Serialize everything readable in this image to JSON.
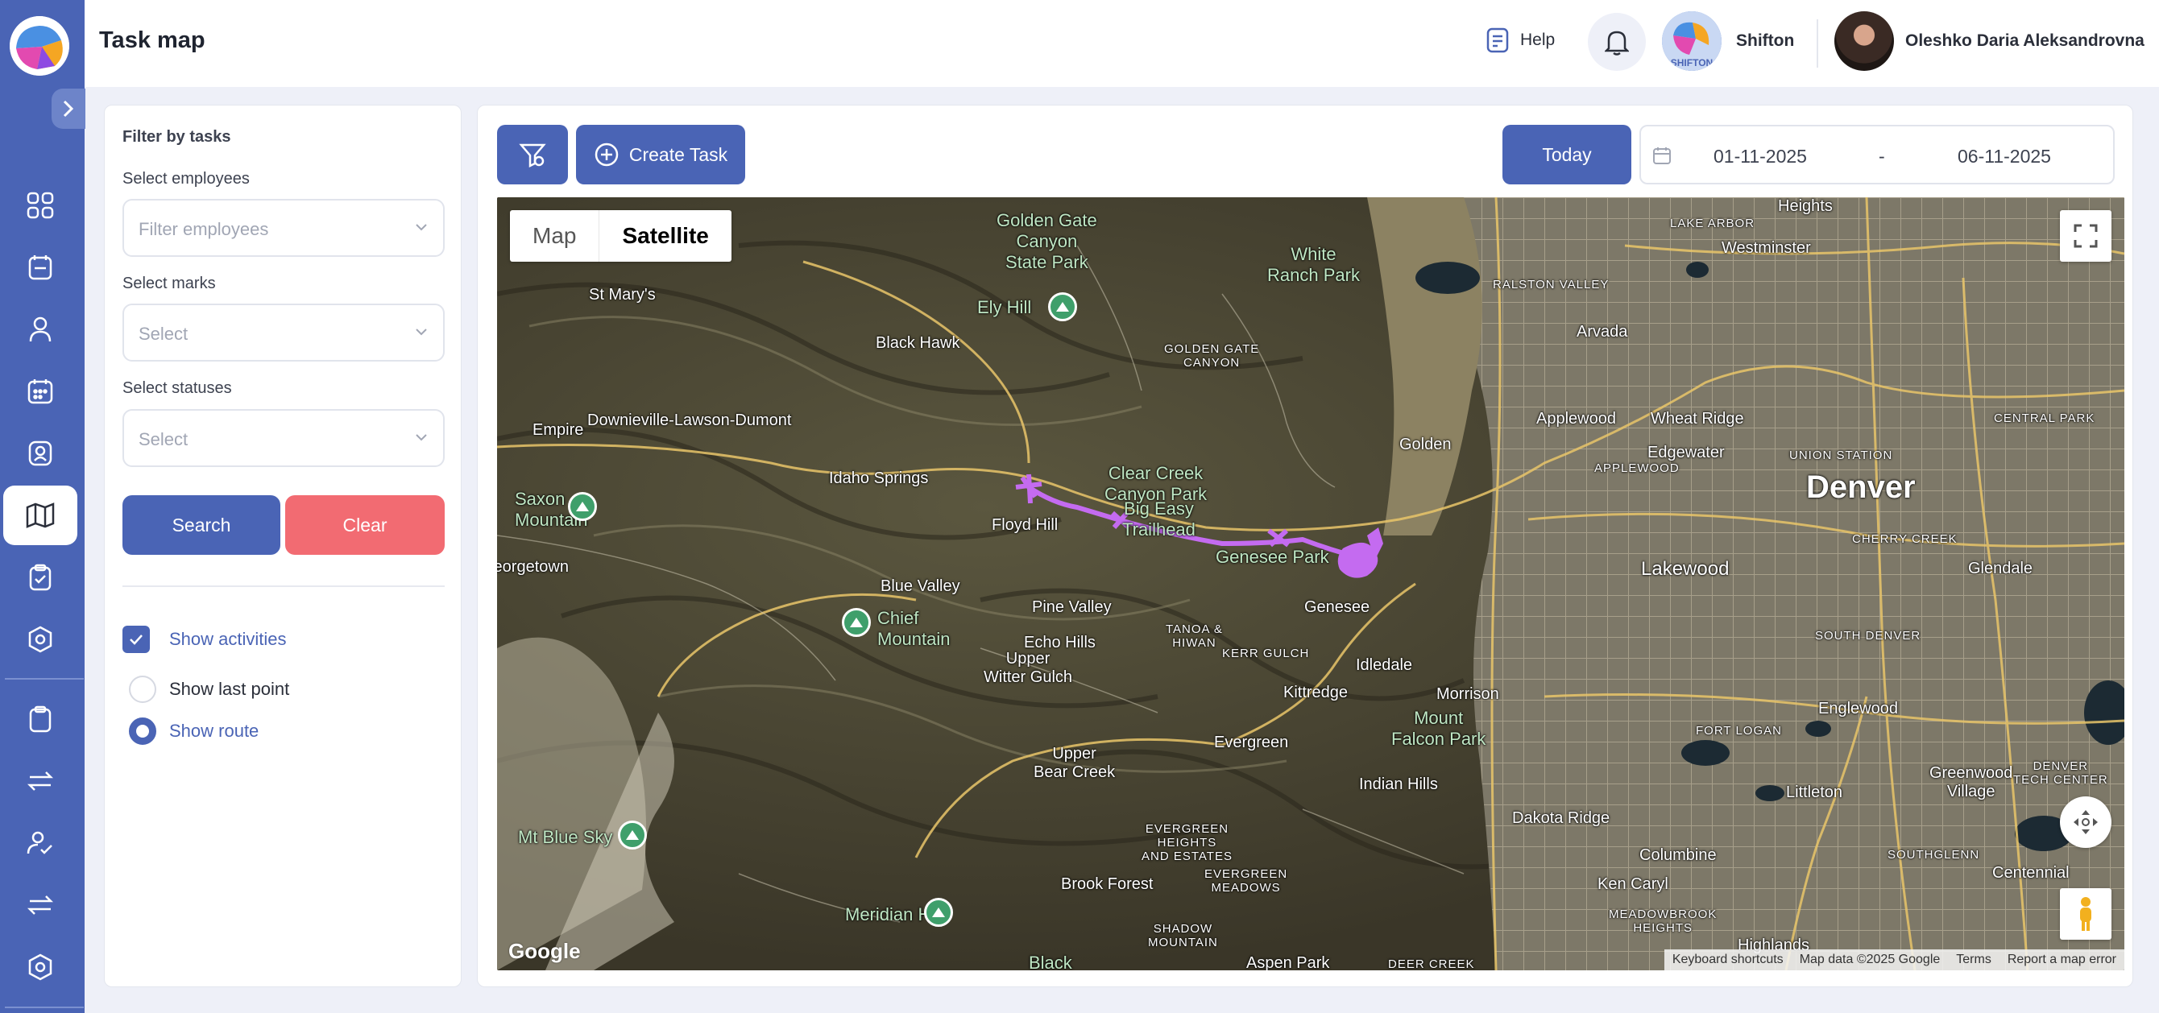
{
  "app": {
    "title": "Task map"
  },
  "header": {
    "help_label": "Help",
    "company_name": "Shifton",
    "company_avatar_text": "SHIFTON",
    "user_name": "Oleshko Daria Aleksandrovna"
  },
  "sidebar": {
    "items": [
      {
        "icon": "dashboard-icon"
      },
      {
        "icon": "calendar-task-icon"
      },
      {
        "icon": "user-icon"
      },
      {
        "icon": "schedule-icon"
      },
      {
        "icon": "employee-badge-icon"
      },
      {
        "icon": "map-icon",
        "active": true
      },
      {
        "icon": "clipboard-check-icon"
      },
      {
        "icon": "settings-icon"
      },
      {
        "icon": "clipboard-icon"
      },
      {
        "icon": "exchange-icon"
      },
      {
        "icon": "user-check-icon"
      },
      {
        "icon": "swap-icon"
      },
      {
        "icon": "gear-icon"
      }
    ]
  },
  "filters": {
    "title": "Filter by tasks",
    "employees_label": "Select employees",
    "employees_placeholder": "Filter employees",
    "marks_label": "Select marks",
    "marks_placeholder": "Select",
    "statuses_label": "Select statuses",
    "statuses_placeholder": "Select",
    "search_label": "Search",
    "clear_label": "Clear",
    "show_activities_label": "Show activities",
    "show_activities_checked": true,
    "show_last_point_label": "Show last point",
    "show_route_label": "Show route",
    "selected_option": "Show route"
  },
  "toolbar": {
    "create_task_label": "Create Task",
    "today_label": "Today",
    "date_from": "01-11-2025",
    "date_separator": "-",
    "date_to": "06-11-2025"
  },
  "map": {
    "type_options": [
      "Map",
      "Satellite"
    ],
    "selected_type": "Satellite",
    "google_logo": "Google",
    "attribution": [
      "Keyboard shortcuts",
      "Map data ©2025 Google",
      "Terms",
      "Report a map error"
    ],
    "route_color": "#c46bf0",
    "labels": {
      "denver": "Denver",
      "lakewood": "Lakewood",
      "golden": "Golden",
      "arvada": "Arvada",
      "wheat_ridge": "Wheat Ridge",
      "edgewater": "Edgewater",
      "applewood": "Applewood",
      "westminster": "Westminster",
      "englewood": "Englewood",
      "littleton": "Littleton",
      "glendale": "Glendale",
      "morrison": "Morrison",
      "genesee": "Genesee",
      "idledale": "Idledale",
      "kittredge": "Kittredge",
      "evergreen": "Evergreen",
      "indian_hills": "Indian Hills",
      "dakota_ridge": "Dakota Ridge",
      "columbine": "Columbine",
      "ken_caryl": "Ken Caryl",
      "idaho_springs": "Idaho Springs",
      "floyd_hill": "Floyd Hill",
      "pine_valley": "Pine Valley",
      "echo_hills": "Echo Hills",
      "upper_witter_gulch": "Upper\nWitter Gulch",
      "upper_bear_creek": "Upper\nBear Creek",
      "blue_valley": "Blue Valley",
      "brook_forest": "Brook Forest",
      "black_hawk": "Black Hawk",
      "st_marys": "St Mary's",
      "empire": "Empire",
      "downieville": "Downieville-Lawson-Dumont",
      "georgetown": "Georgetown",
      "highlands": "Highlands",
      "centennial": "Centennial",
      "greenwood_village": "Greenwood\nVillage",
      "golden_gate_park": "Golden Gate\nCanyon\nState Park",
      "white_ranch_park": "White\nRanch Park",
      "clear_creek_park": "Clear Creek\nCanyon Park",
      "big_easy": "Big Easy\nTrailhead",
      "genesee_park": "Genesee Park",
      "mount_falcon": "Mount\nFalcon Park",
      "ely_hill": "Ely Hill",
      "saxon_mountain": "Saxon\nMountain",
      "chief_mountain": "Chief\nMountain",
      "mt_blue_sky": "Mt Blue Sky",
      "meridian_hill": "Meridian Hill",
      "black": "Black",
      "lake_arbor": "LAKE ARBOR",
      "ralston_valley": "RALSTON VALLEY",
      "golden_gate_canyon": "GOLDEN GATE\nCANYON",
      "union_station": "UNION STATION",
      "central_park": "CENTRAL PARK",
      "applewood_caps": "APPLEWOOD",
      "cherry_creek": "CHERRY CREEK",
      "south_denver": "SOUTH DENVER",
      "fort_logan": "FORT LOGAN",
      "tanoa": "TANOA &\nHIWAN",
      "kerr_gulch": "KERR GULCH",
      "evergreen_heights": "EVERGREEN\nHEIGHTS\nAND ESTATES",
      "evergreen_meadows": "EVERGREEN\nMEADOWS",
      "shadow_mountain": "SHADOW\nMOUNTAIN",
      "meadowbrook": "MEADOWBROOK\nHEIGHTS",
      "southglenn": "SOUTHGLENN",
      "deer_creek": "DEER CREEK",
      "denver_tech": "DENVER\nTECH CENTER",
      "heights": "Heights",
      "aspen_park": "Aspen Park"
    }
  }
}
